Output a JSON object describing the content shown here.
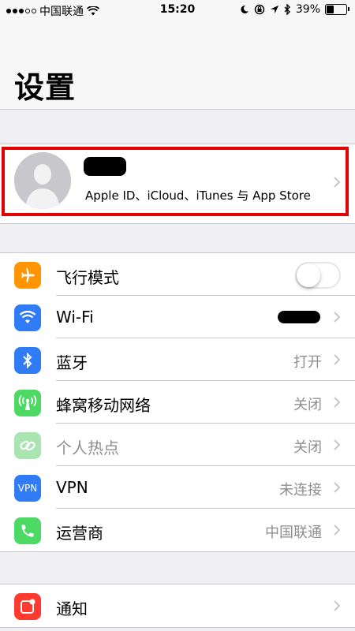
{
  "status_bar": {
    "carrier": "中国联通",
    "time": "15:20",
    "battery": "39%",
    "battery_level": 0.39
  },
  "nav": {
    "title": "设置"
  },
  "profile": {
    "subtitle": "Apple ID、iCloud、iTunes 与 App Store"
  },
  "settings": {
    "airplane": {
      "label": "飞行模式",
      "on": false
    },
    "wifi": {
      "label": "Wi-Fi"
    },
    "bluetooth": {
      "label": "蓝牙",
      "value": "打开"
    },
    "cellular": {
      "label": "蜂窝移动网络",
      "value": "关闭"
    },
    "hotspot": {
      "label": "个人热点",
      "value": "关闭"
    },
    "vpn": {
      "label": "VPN",
      "value": "未连接",
      "icon_text": "VPN"
    },
    "carrier": {
      "label": "运营商",
      "value": "中国联通"
    },
    "notifications": {
      "label": "通知"
    }
  },
  "colors": {
    "airplane": "#ff9500",
    "wifi": "#2f7cf6",
    "bluetooth": "#2f7cf6",
    "cellular": "#4cd964",
    "hotspot": "#a8e5b1",
    "vpn": "#2f7cf6",
    "carrier": "#4cd964",
    "notifications": "#ff3b30",
    "highlight": "#e30000"
  }
}
